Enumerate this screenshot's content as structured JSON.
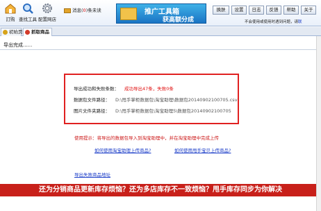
{
  "toolbar": {
    "items": [
      {
        "label": "訂购",
        "icon": "home-icon"
      },
      {
        "label": "查找工具",
        "icon": "search-icon"
      },
      {
        "label": "配置网店",
        "icon": "gear-icon"
      }
    ],
    "message": {
      "label": "消息(",
      "count": "0",
      "suffix": ")条未读"
    },
    "banner": {
      "line1": "推广工具箱",
      "line2": "获高额分成"
    },
    "buttons": [
      "换肤",
      "设置",
      "日志",
      "反馈",
      "帮助",
      "关于"
    ],
    "hint": {
      "text": "不会使用或使用时遇到问题，请",
      "link": "联"
    }
  },
  "tabs": [
    {
      "label": "初始页",
      "color": "#d7a319"
    },
    {
      "label": "抓取商品",
      "color": "#d23a2a"
    }
  ],
  "status": "导出完成......",
  "result": {
    "rows": [
      {
        "label": "导出成功和失败条数：",
        "value": "成功导出47条，失败0条"
      },
      {
        "label": "数据包文件路径：",
        "value": "D:\\甩手掌柜数据包\\淘宝助理\\数据包20140902100705.csv"
      },
      {
        "label": "图片文件夹路径：",
        "value": "D:\\甩手掌柜数据包\\淘宝助理5\\数据包20140902100705"
      }
    ]
  },
  "note": "使用提示：将导出的数据包导入到淘宝助理中，并在淘宝助理中完成上传",
  "links": {
    "tb_assistant": "如何使用淘宝助理上传商品?",
    "shuaishou": "如何使用甩手宝贝上传商品?",
    "failed": "导出失败商品地址"
  },
  "ad": "还为分销商品更新库存烦恼？还为多店库存不一致烦恼？甩手库存同步为你解决"
}
